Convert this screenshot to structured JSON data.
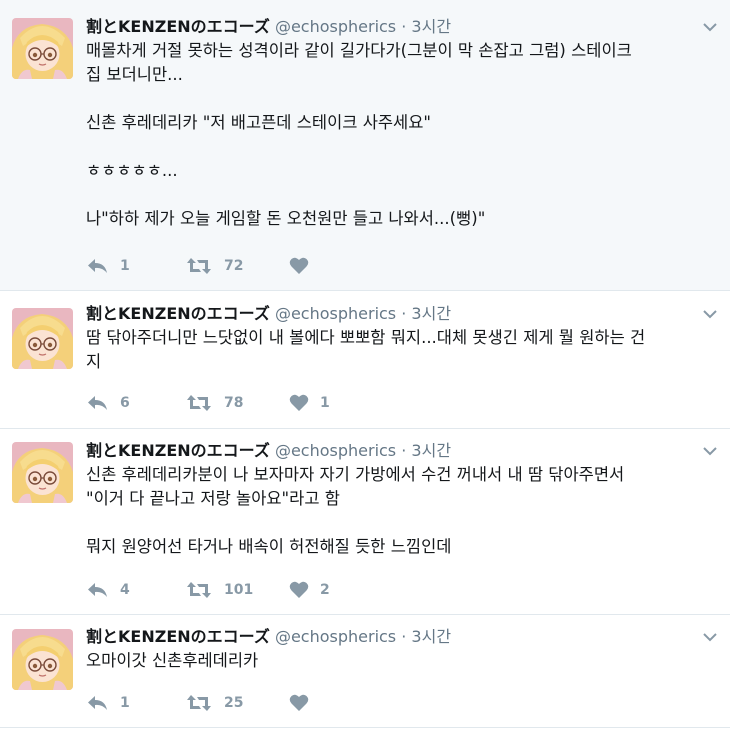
{
  "tweets": [
    {
      "name": "割とKENZENのエコーズ",
      "handle": "@echospherics",
      "separator": "·",
      "time": "3시간",
      "text": "매몰차게 거절 못하는 성격이라 같이 길가다가(그분이 막 손잡고 그럼) 스테이크\n집 보더니만...\n\n신촌 후레데리카 \"저 배고픈데 스테이크 사주세요\"\n\nㅎㅎㅎㅎㅎ...\n\n나\"하하 제가 오늘 게임할 돈 오천원만 들고 나와서...(뻥)\"",
      "reply_count": "1",
      "retweet_count": "72",
      "like_count": ""
    },
    {
      "name": "割とKENZENのエコーズ",
      "handle": "@echospherics",
      "separator": "·",
      "time": "3시간",
      "text": "땀 닦아주더니만 느닷없이 내 볼에다 뽀뽀함 뭐지...대체 못생긴 제게 뭘 원하는 건\n지",
      "reply_count": "6",
      "retweet_count": "78",
      "like_count": "1"
    },
    {
      "name": "割とKENZENのエコーズ",
      "handle": "@echospherics",
      "separator": "·",
      "time": "3시간",
      "text": "신촌 후레데리카분이 나 보자마자 자기 가방에서 수건 꺼내서 내 땀 닦아주면서\n\"이거 다 끝나고 저랑 놀아요\"라고 함\n\n뭐지 원양어선 타거나 배속이 허전해질 듯한 느낌인데",
      "reply_count": "4",
      "retweet_count": "101",
      "like_count": "2"
    },
    {
      "name": "割とKENZENのエコーズ",
      "handle": "@echospherics",
      "separator": "·",
      "time": "3시간",
      "text": "오마이갓 신촌후레데리카",
      "reply_count": "1",
      "retweet_count": "25",
      "like_count": ""
    }
  ],
  "colors": {
    "highlight_bg": "#f5f8fa",
    "border": "#e1e8ed",
    "muted": "#657786",
    "icon": "#8899a6"
  },
  "icons": [
    "avatar",
    "chevron-down-icon",
    "reply-icon",
    "retweet-icon",
    "heart-icon"
  ]
}
